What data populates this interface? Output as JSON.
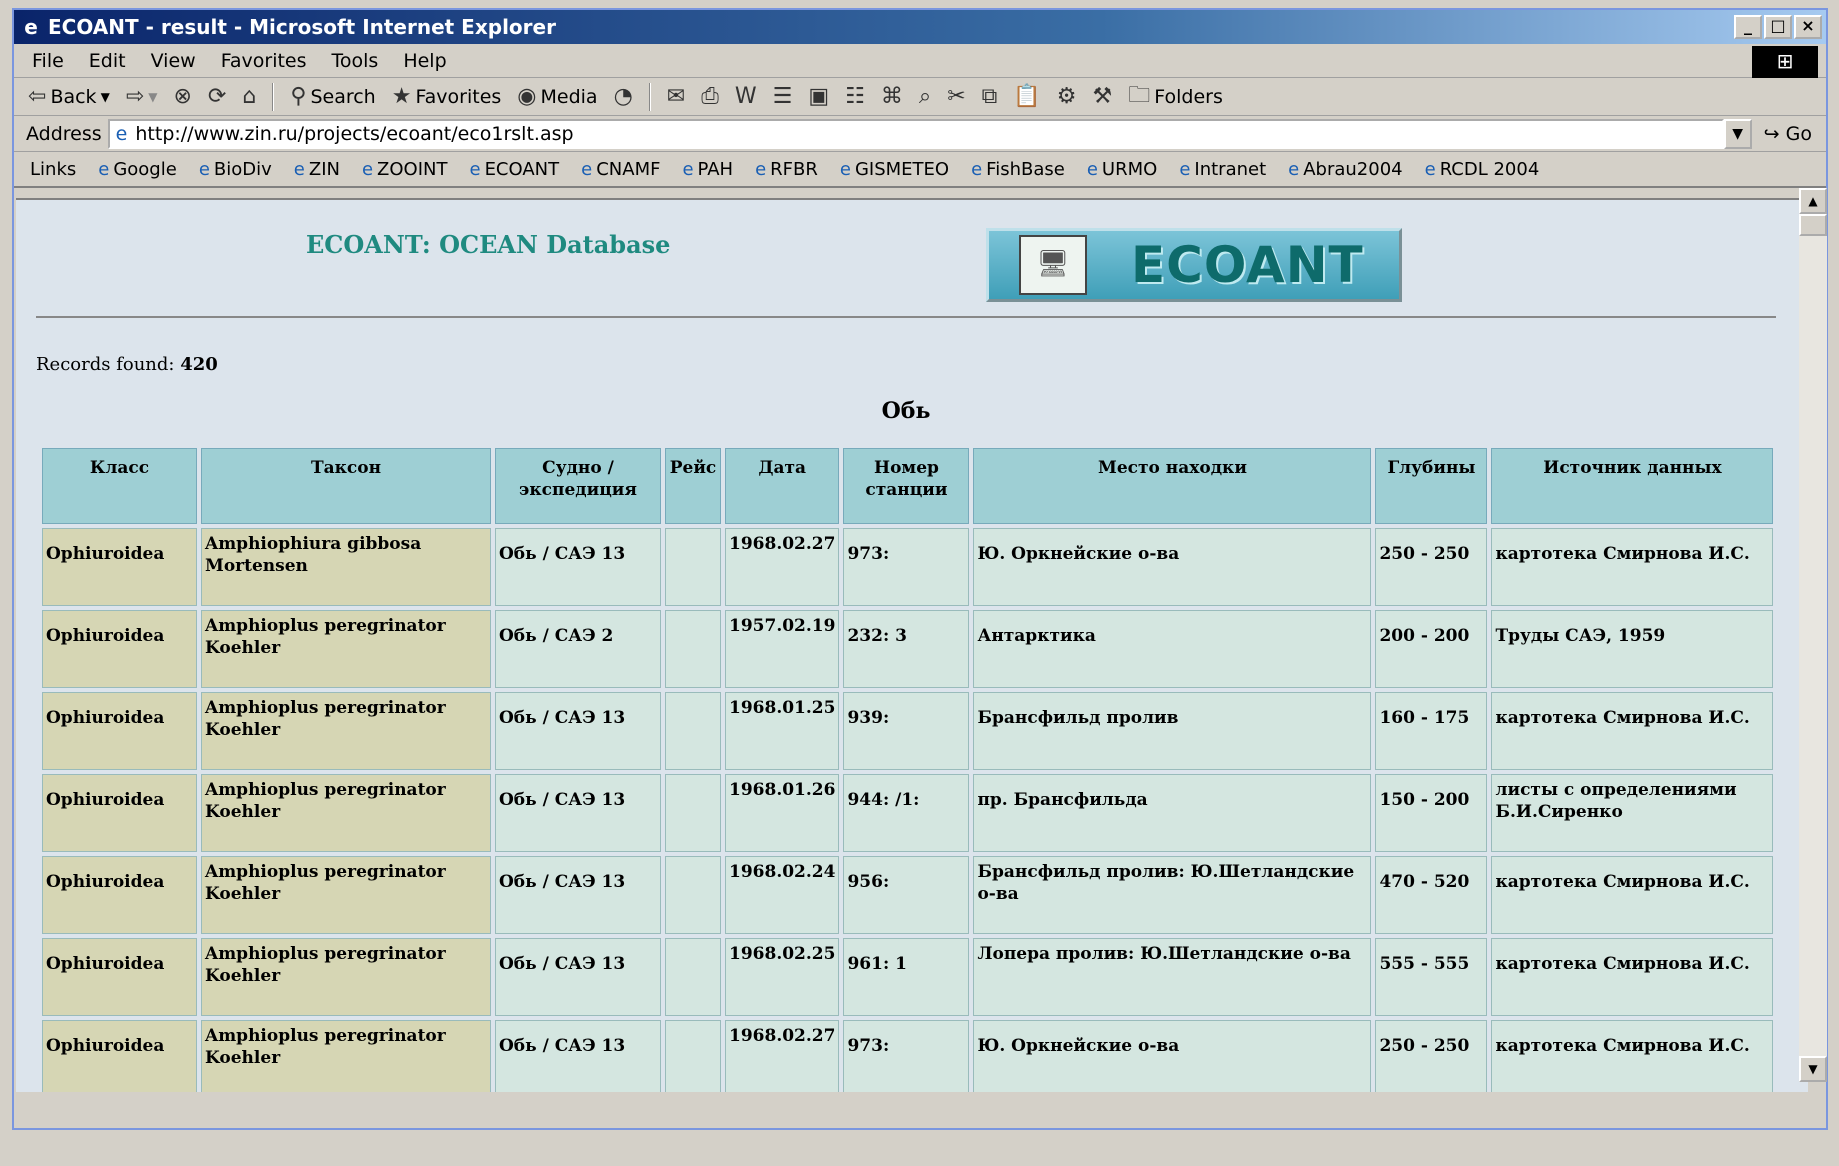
{
  "window": {
    "title": "ECOANT - result - Microsoft Internet Explorer"
  },
  "menu": [
    "File",
    "Edit",
    "View",
    "Favorites",
    "Tools",
    "Help"
  ],
  "toolbar": {
    "back": "Back",
    "search": "Search",
    "favorites": "Favorites",
    "media": "Media",
    "folders": "Folders"
  },
  "address": {
    "label": "Address",
    "url": "http://www.zin.ru/projects/ecoant/eco1rslt.asp",
    "go": "Go"
  },
  "links": {
    "label": "Links",
    "items": [
      "Google",
      "BioDiv",
      "ZIN",
      "ZOOINT",
      "ECOANT",
      "CNAMF",
      "PAH",
      "RFBR",
      "GISMETEO",
      "FishBase",
      "URMO",
      "Intranet",
      "Abrau2004",
      "RCDL 2004"
    ]
  },
  "page": {
    "title": "ECOANT: OCEAN Database",
    "logo_text": "ECOANT",
    "records_label": "Records found:",
    "records_count": "420",
    "section": "Обь"
  },
  "table": {
    "headers": [
      "Класс",
      "Таксон",
      "Судно / экспедиция",
      "Рейс",
      "Дата",
      "Номер станции",
      "Место находки",
      "Глубины",
      "Источник данных"
    ],
    "rows": [
      [
        "Ophiuroidea",
        "Amphiophiura gibbosa Mortensen",
        "Обь / САЭ 13",
        "",
        "1968.02.27",
        "973:",
        "Ю. Оркнейские о-ва",
        "250 - 250",
        "картотека Смирнова И.С."
      ],
      [
        "Ophiuroidea",
        "Amphioplus peregrinator Koehler",
        "Обь / САЭ 2",
        "",
        "1957.02.19",
        "232: 3",
        "Антарктика",
        "200 - 200",
        "Труды САЭ, 1959"
      ],
      [
        "Ophiuroidea",
        "Amphioplus peregrinator Koehler",
        "Обь / САЭ 13",
        "",
        "1968.01.25",
        "939:",
        "Брансфильд пролив",
        "160 - 175",
        "картотека Смирнова И.С."
      ],
      [
        "Ophiuroidea",
        "Amphioplus peregrinator Koehler",
        "Обь / САЭ 13",
        "",
        "1968.01.26",
        "944: /1:",
        "пр. Брансфильда",
        "150 - 200",
        "листы с определениями Б.И.Сиренко"
      ],
      [
        "Ophiuroidea",
        "Amphioplus peregrinator Koehler",
        "Обь / САЭ 13",
        "",
        "1968.02.24",
        "956:",
        "Брансфильд пролив: Ю.Шетландские о-ва",
        "470 - 520",
        "картотека Смирнова И.С."
      ],
      [
        "Ophiuroidea",
        "Amphioplus peregrinator Koehler",
        "Обь / САЭ 13",
        "",
        "1968.02.25",
        "961: 1",
        "Лопера пролив: Ю.Шетландские о-ва",
        "555 - 555",
        "картотека Смирнова И.С."
      ],
      [
        "Ophiuroidea",
        "Amphioplus peregrinator Koehler",
        "Обь / САЭ 13",
        "",
        "1968.02.27",
        "973:",
        "Ю. Оркнейские о-ва",
        "250 - 250",
        "картотека Смирнова И.С."
      ]
    ]
  }
}
